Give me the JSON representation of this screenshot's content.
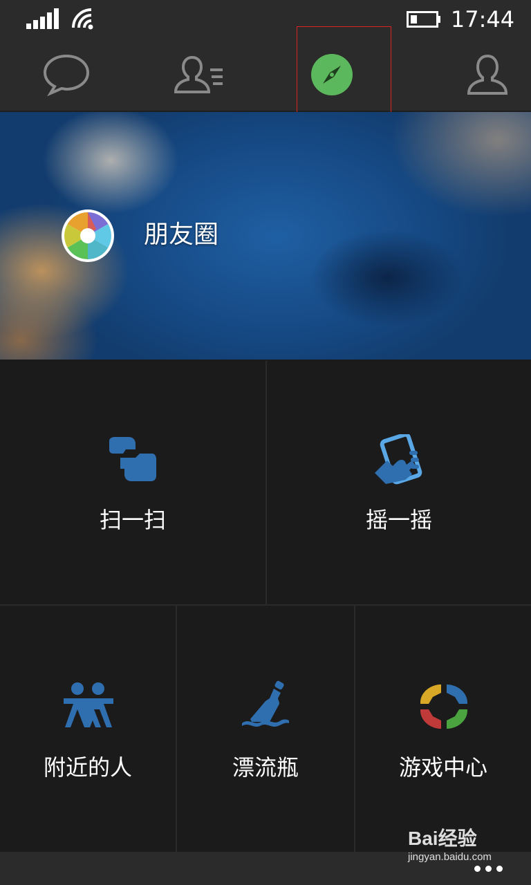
{
  "status_bar": {
    "time": "17:44",
    "signal_icon": "signal-strength-icon",
    "wifi_icon": "wifi-icon",
    "battery_icon": "battery-low-icon",
    "battery_level": 0.25
  },
  "tabs": [
    {
      "name": "chats",
      "icon": "chat-bubble-icon",
      "active": false
    },
    {
      "name": "contacts",
      "icon": "contacts-list-icon",
      "active": false
    },
    {
      "name": "discover",
      "icon": "compass-icon",
      "active": true
    },
    {
      "name": "me",
      "icon": "person-icon",
      "active": false
    }
  ],
  "banner": {
    "label": "朋友圈",
    "icon": "moments-aperture-icon"
  },
  "grid": {
    "scan": {
      "label": "扫一扫",
      "icon": "scan-icon"
    },
    "shake": {
      "label": "摇一摇",
      "icon": "shake-phone-icon"
    },
    "nearby": {
      "label": "附近的人",
      "icon": "people-nearby-icon"
    },
    "bottle": {
      "label": "漂流瓶",
      "icon": "drift-bottle-icon"
    },
    "games": {
      "label": "游戏中心",
      "icon": "game-center-icon"
    }
  },
  "watermark": {
    "top": "Bai经验",
    "bottom": "jingyan.baidu.com"
  },
  "colors": {
    "accent_green": "#5cb85c",
    "icon_blue": "#2f6fb0",
    "background": "#1a1a1a",
    "bar": "#2b2b2b"
  }
}
